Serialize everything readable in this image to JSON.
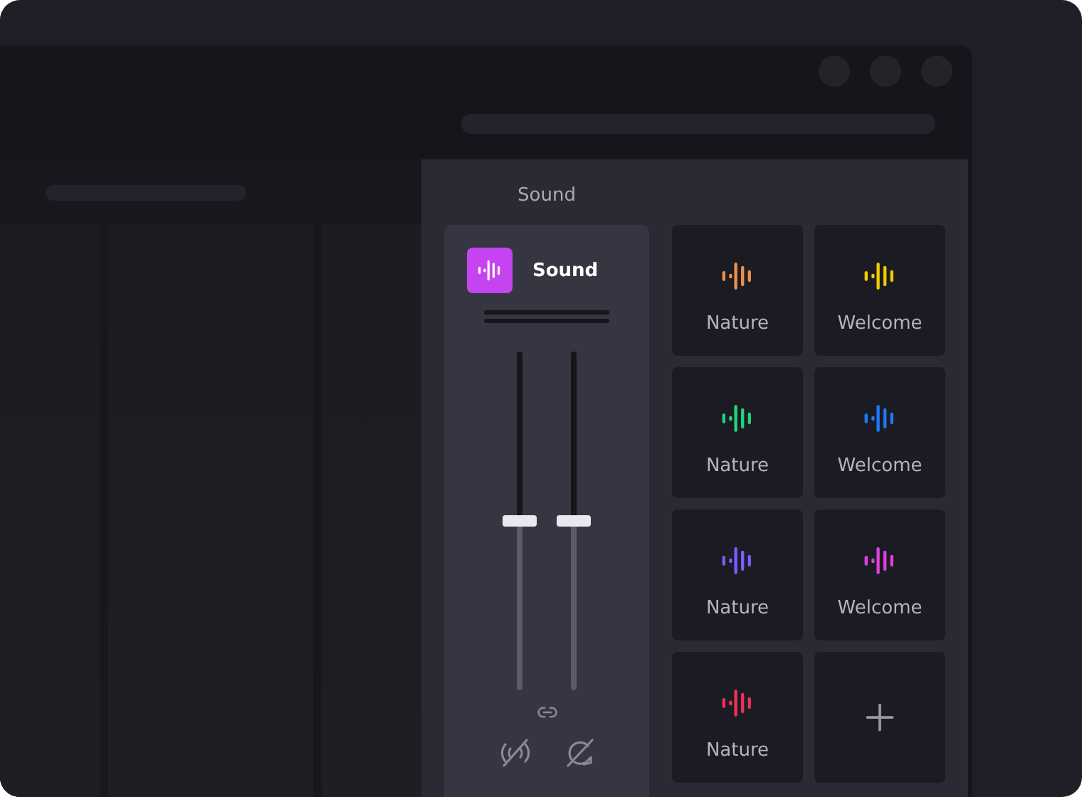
{
  "panel": {
    "title": "Sound"
  },
  "mixer": {
    "label": "Sound",
    "faders": [
      {
        "level": 0.5
      },
      {
        "level": 0.5
      }
    ]
  },
  "sounds": [
    {
      "kind": "sound",
      "label": "Nature",
      "color": "#f0904a"
    },
    {
      "kind": "sound",
      "label": "Welcome",
      "color": "#f2cc00"
    },
    {
      "kind": "sound",
      "label": "Nature",
      "color": "#22d47a"
    },
    {
      "kind": "sound",
      "label": "Welcome",
      "color": "#1f78ff"
    },
    {
      "kind": "sound",
      "label": "Nature",
      "color": "#7b5cff"
    },
    {
      "kind": "sound",
      "label": "Welcome",
      "color": "#e040e0"
    },
    {
      "kind": "sound",
      "label": "Nature",
      "color": "#f0305a"
    },
    {
      "kind": "add"
    }
  ]
}
